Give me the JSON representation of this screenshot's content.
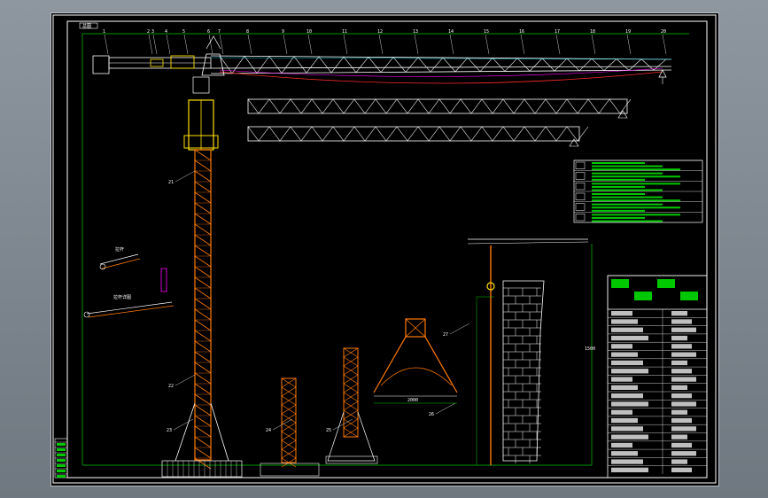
{
  "drawing": {
    "title_tag": "总图",
    "colors": {
      "background": "#000000",
      "frame": "#ffffff",
      "border": "#00c800",
      "tower": "#ff7a00",
      "head": "#ffe000",
      "jib": "#ffffff",
      "hoist": "#ff2a2a",
      "table_fill": "#00c800",
      "magenta": "#ff00ff",
      "cyan": "#00e5ff"
    },
    "jib_callouts": [
      "1",
      "2",
      "3",
      "4",
      "5",
      "6",
      "7",
      "8",
      "9",
      "10",
      "11",
      "12",
      "13",
      "14",
      "15",
      "16",
      "17",
      "18",
      "19",
      "20"
    ],
    "tower_callouts": [
      "21",
      "22",
      "23",
      "24",
      "25",
      "26",
      "27"
    ],
    "detail_labels": [
      "拉杆",
      "拉杆详图",
      "2000",
      "1500"
    ],
    "spec_table": {
      "rows": 6
    },
    "title_block": {
      "rows": 20
    }
  }
}
